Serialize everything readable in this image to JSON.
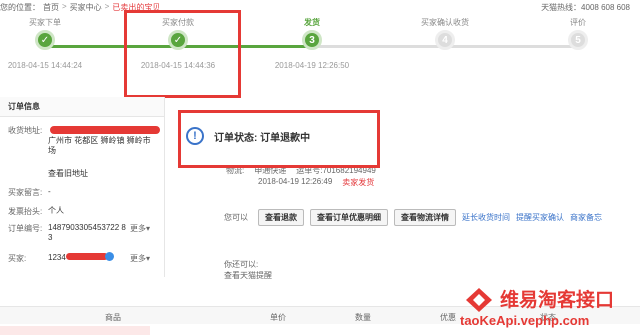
{
  "breadcrumb": {
    "prefix": "您的位置：",
    "items": [
      "首页",
      "买家中心",
      "已卖出的宝贝"
    ],
    "separator": ">"
  },
  "hotline": "天猫热线：4008 608 608",
  "steps": [
    {
      "label": "买家下单",
      "marker": "✓",
      "time": "2018-04-15 14:44:24",
      "state": "done"
    },
    {
      "label": "买家付款",
      "marker": "✓",
      "time": "2018-04-15 14:44:36",
      "state": "done"
    },
    {
      "label": "发货",
      "marker": "3",
      "time": "2018-04-19 12:26:50",
      "state": "current"
    },
    {
      "label": "买家确认收货",
      "marker": "4",
      "time": "",
      "state": "todo"
    },
    {
      "label": "评价",
      "marker": "5",
      "time": "",
      "state": "todo"
    }
  ],
  "order_info": {
    "title": "订单信息",
    "address_label": "收货地址:",
    "address_value": "广州市 花都区 狮岭镇 狮岭市场",
    "view_old_address": "查看旧地址",
    "message_label": "买家留言:",
    "message_value": "-",
    "invoice_label": "发票抬头:",
    "invoice_value": "个人",
    "order_no_label": "订单编号:",
    "order_no_value": "1487903305453722 8 3",
    "more_1": "更多",
    "buyer_label": "买家:",
    "buyer_value": "1234",
    "more_2": "更多"
  },
  "status": {
    "icon": "info-icon",
    "text": "订单状态: 订单退款中",
    "logistics": [
      "物流:",
      "申通快递",
      "运单号:701682194949"
    ],
    "log_time": "2018-04-19 12:26:49",
    "log_status": "卖家发货"
  },
  "actions": {
    "lead": "您可以",
    "buttons": [
      "查看退款",
      "查看订单优惠明细",
      "查看物流详情"
    ],
    "links": [
      "延长收货时间",
      "提醒买家确认",
      "商家备忘"
    ]
  },
  "youcan": {
    "title": "你还可以:",
    "item": "查看天猫提醒"
  },
  "table_headers": [
    "商品",
    "单价",
    "数量",
    "优惠",
    "状态"
  ],
  "watermark": {
    "cn": "维易淘客接口",
    "url": "taoKeApi.vephp.com"
  },
  "colors": {
    "green": "#59a53e",
    "red_box": "#e53935",
    "link": "#3a73c9"
  }
}
